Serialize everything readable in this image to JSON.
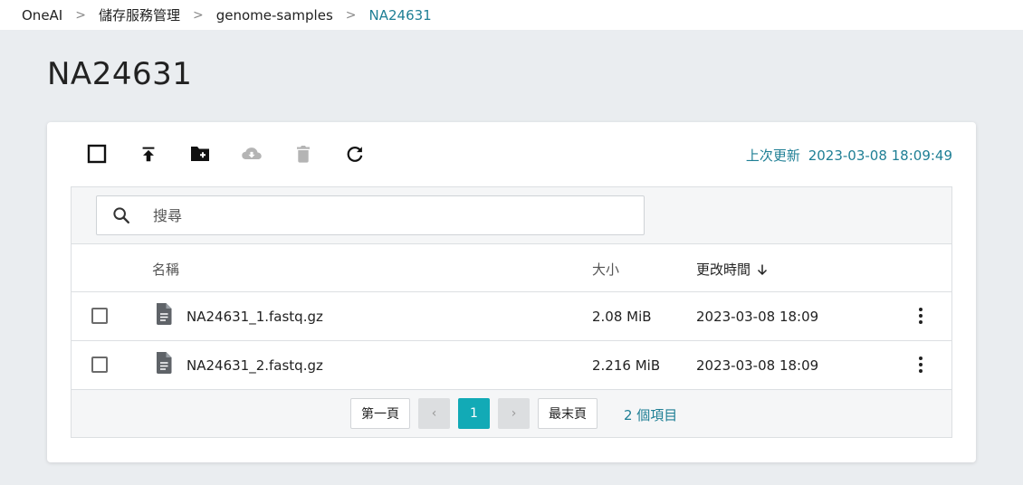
{
  "breadcrumb": {
    "items": [
      "OneAI",
      "儲存服務管理",
      "genome-samples",
      "NA24631"
    ],
    "separator": ">"
  },
  "page": {
    "title": "NA24631"
  },
  "toolbar": {
    "icons": [
      "checkbox-icon",
      "upload-icon",
      "new-folder-icon",
      "download-icon",
      "delete-icon",
      "refresh-icon"
    ],
    "last_update_label": "上次更新",
    "last_update_time": "2023-03-08 18:09:49"
  },
  "search": {
    "placeholder": "搜尋",
    "value": ""
  },
  "table": {
    "headers": {
      "name": "名稱",
      "size": "大小",
      "modified": "更改時間"
    },
    "sort": {
      "column": "modified",
      "direction": "descending"
    },
    "rows": [
      {
        "name": "NA24631_1.fastq.gz",
        "size": "2.08 MiB",
        "modified": "2023-03-08 18:09"
      },
      {
        "name": "NA24631_2.fastq.gz",
        "size": "2.216 MiB",
        "modified": "2023-03-08 18:09"
      }
    ]
  },
  "pagination": {
    "first": "第一頁",
    "prev": "‹",
    "current_page": "1",
    "next": "›",
    "last": "最末頁",
    "item_count": "2 個項目"
  },
  "colors": {
    "accent": "#1f7f95",
    "active_page": "#12aab6",
    "background": "#eaedf0"
  }
}
